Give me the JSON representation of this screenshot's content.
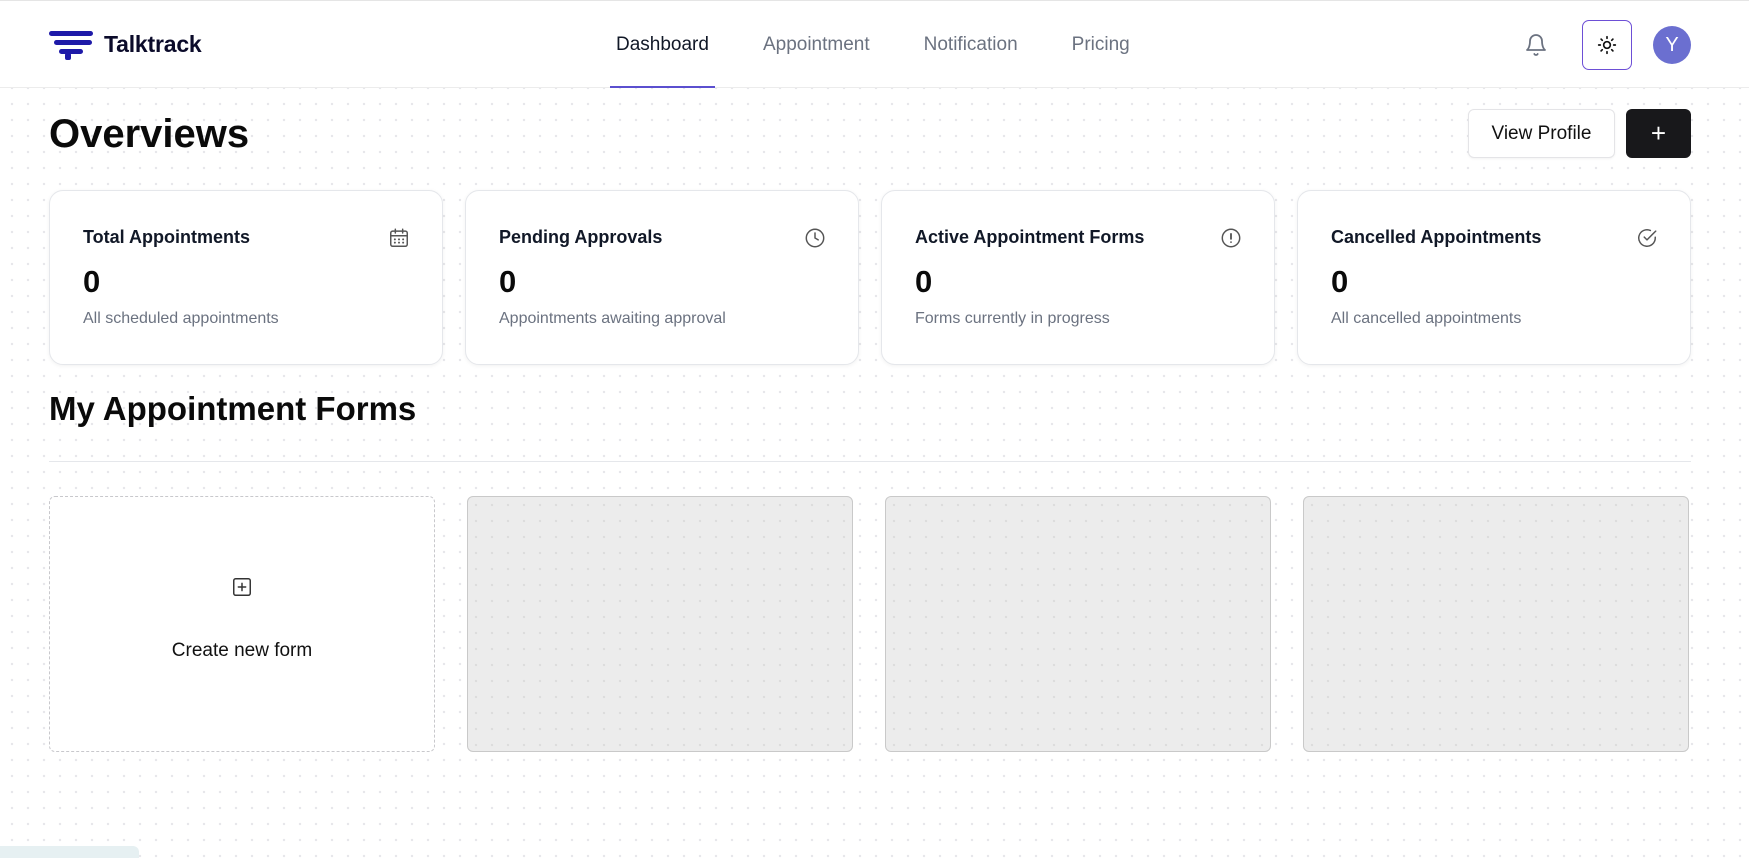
{
  "header": {
    "brand": "Talktrack",
    "nav": [
      {
        "label": "Dashboard",
        "active": true
      },
      {
        "label": "Appointment",
        "active": false
      },
      {
        "label": "Notification",
        "active": false
      },
      {
        "label": "Pricing",
        "active": false
      }
    ],
    "avatar_initial": "Y",
    "accent_color": "#5b4fcf"
  },
  "overview": {
    "title": "Overviews",
    "view_profile_label": "View Profile",
    "add_label": "+"
  },
  "stats": [
    {
      "title": "Total Appointments",
      "value": "0",
      "description": "All scheduled appointments",
      "icon": "calendar-icon"
    },
    {
      "title": "Pending Approvals",
      "value": "0",
      "description": "Appointments awaiting approval",
      "icon": "clock-icon"
    },
    {
      "title": "Active Appointment Forms",
      "value": "0",
      "description": "Forms currently in progress",
      "icon": "alert-circle-icon"
    },
    {
      "title": "Cancelled Appointments",
      "value": "0",
      "description": "All cancelled appointments",
      "icon": "check-circle-icon"
    }
  ],
  "forms_section": {
    "title": "My Appointment Forms",
    "create_label": "Create new form"
  }
}
